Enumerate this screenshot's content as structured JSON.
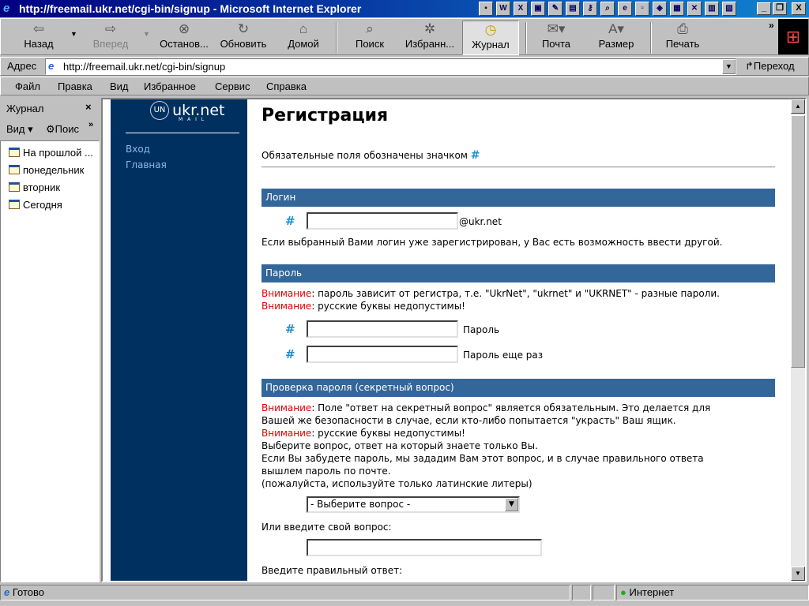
{
  "window": {
    "title": "http://freemail.ukr.net/cgi-bin/signup - Microsoft Internet Explorer"
  },
  "toolbar": {
    "buttons": [
      {
        "label": "Назад",
        "icon": "back-arrow-icon"
      },
      {
        "label": "Вперед",
        "icon": "forward-arrow-icon"
      },
      {
        "label": "Останов...",
        "icon": "stop-icon"
      },
      {
        "label": "Обновить",
        "icon": "refresh-icon"
      },
      {
        "label": "Домой",
        "icon": "home-icon"
      },
      {
        "label": "Поиск",
        "icon": "search-icon"
      },
      {
        "label": "Избранн...",
        "icon": "favorites-icon"
      },
      {
        "label": "Журнал",
        "icon": "history-icon"
      },
      {
        "label": "Почта",
        "icon": "mail-icon"
      },
      {
        "label": "Размер",
        "icon": "font-size-icon"
      },
      {
        "label": "Печать",
        "icon": "print-icon"
      }
    ]
  },
  "address": {
    "label": "Адрес",
    "url": "http://freemail.ukr.net/cgi-bin/signup",
    "go": "Переход"
  },
  "menu": [
    "Файл",
    "Правка",
    "Вид",
    "Избранное",
    "Сервис",
    "Справка"
  ],
  "history_panel": {
    "title": "Журнал",
    "view": "Вид",
    "search": "Поис",
    "items": [
      "На прошлой ...",
      "понедельник",
      "вторник",
      "Сегодня"
    ]
  },
  "site": {
    "logo": "ukr.net",
    "logo_sub": "M A I L",
    "nav": [
      "Вход",
      "Главная"
    ],
    "page_title": "Регистрация",
    "required_note": "Обязательные поля обозначены значком",
    "required_mark": "#",
    "login": {
      "header": "Логин",
      "suffix": "@ukr.net",
      "note": "Если выбранный Вами логин уже зарегистрирован, у Вас есть возможность ввести другой.",
      "value": ""
    },
    "password": {
      "header": "Пароль",
      "warn_label": "Внимание",
      "warn1": ": пароль зависит от регистра, т.е. \"UkrNet\", \"ukrnet\" и \"UKRNET\" - разные пароли.",
      "warn2": ": русские буквы недопустимы!",
      "field1": "Пароль",
      "field2": "Пароль еще раз"
    },
    "secret": {
      "header": "Проверка пароля (секретный вопрос)",
      "warn1a": ": Поле \"ответ на секретный вопрос\" является обязательным. Это делается для",
      "warn1b": "Вашей же безопасности в случае, если кто-либо попытается \"украсть\" Ваш ящик.",
      "warn2": ": русские буквы недопустимы!",
      "line1": "Выберите вопрос, ответ на который знаете только Вы.",
      "line2": "Если Вы забудете пароль, мы зададим Вам этот вопрос, и в случае правильного ответа",
      "line3": "вышлем пароль по почте.",
      "line4": "(пожалуйста, используйте только латинские литеры)",
      "select": "- Выберите вопрос -",
      "own_q": "Или введите свой вопрос:",
      "answer": "Введите правильный ответ:"
    }
  },
  "status": {
    "text": "Готово",
    "zone": "Интернет"
  }
}
